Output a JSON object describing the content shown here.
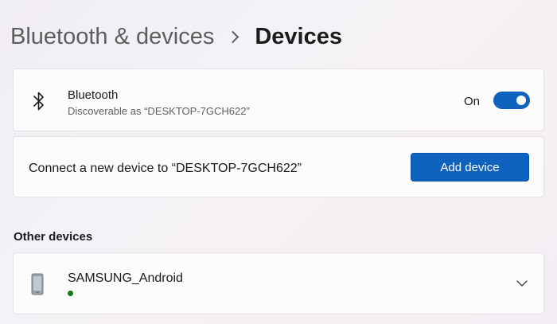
{
  "breadcrumb": {
    "parent": "Bluetooth & devices",
    "current": "Devices"
  },
  "bluetooth": {
    "title": "Bluetooth",
    "subtitle": "Discoverable as “DESKTOP-7GCH622”",
    "toggle_label": "On",
    "toggle_state": "on",
    "icon": "bluetooth-icon"
  },
  "connect": {
    "text": "Connect a new device to “DESKTOP-7GCH622”",
    "button_label": "Add device"
  },
  "other_devices": {
    "heading": "Other devices",
    "items": [
      {
        "name": "SAMSUNG_Android",
        "icon": "phone-icon",
        "status_color": "#107c10"
      }
    ]
  },
  "colors": {
    "accent": "#0f62be",
    "status_connected": "#107c10"
  }
}
